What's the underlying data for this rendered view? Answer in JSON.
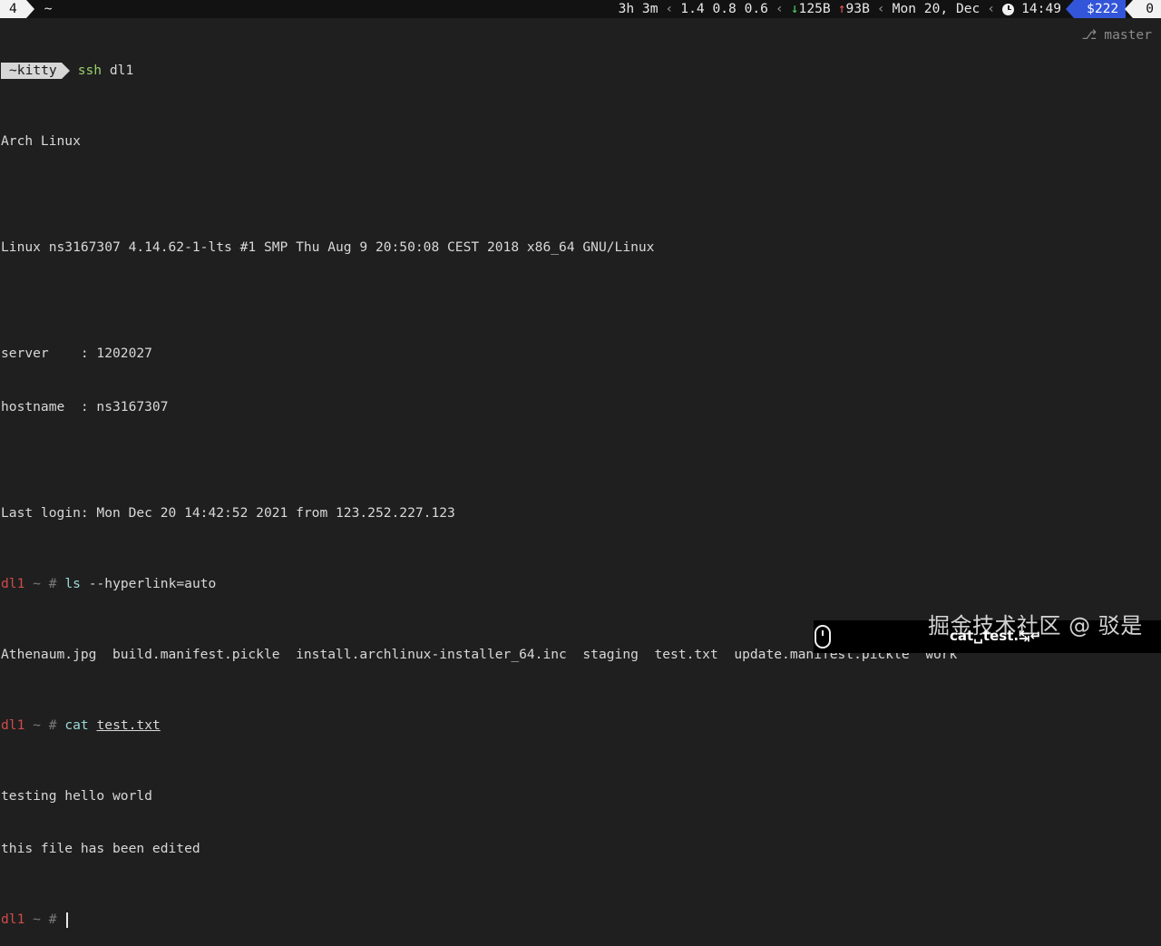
{
  "tabbar": {
    "active_tab": "4",
    "inactive_tab": "~"
  },
  "status": {
    "uptime": "3h 3m",
    "load": "1.4 0.8 0.6",
    "net_down": "125B",
    "net_up": "93B",
    "date": "Mon 20, Dec",
    "time": "14:49",
    "money": "$222",
    "count": "0"
  },
  "prompt": {
    "segment": "~kitty",
    "command_word": "ssh",
    "command_arg": "dl1",
    "git_branch": "master"
  },
  "terminal": {
    "lines": [
      "Arch Linux",
      "",
      "Linux ns3167307 4.14.62-1-lts #1 SMP Thu Aug 9 20:50:08 CEST 2018 x86_64 GNU/Linux",
      "",
      "server    : 1202027",
      "hostname  : ns3167307",
      "",
      "Last login: Mon Dec 20 14:42:52 2021 from 123.252.227.123"
    ],
    "host": "dl1",
    "tilde": "~",
    "hash": "#",
    "cmd1_name": "ls",
    "cmd1_args": "--hyperlink=auto",
    "ls_output": "Athenaum.jpg  build.manifest.pickle  install.archlinux-installer_64.inc  staging  test.txt  update.manifest.pickle  work",
    "cmd2_name": "cat",
    "cmd2_arg": "test.txt",
    "cat_output": [
      "testing hello world",
      "this file has been edited"
    ]
  },
  "overlay": {
    "keys": "cat␣test.↹↵",
    "watermark": "掘金技术社区 @ 驳是"
  },
  "colors": {
    "background": "#1f1f1f",
    "host": "#d14a4a",
    "accent_money": "#3255d9",
    "net_down": "#52d06b",
    "net_up": "#e55555"
  },
  "icons": [
    "clock-icon",
    "branch-icon",
    "mouse-icon",
    "download-arrow-icon",
    "upload-arrow-icon"
  ]
}
